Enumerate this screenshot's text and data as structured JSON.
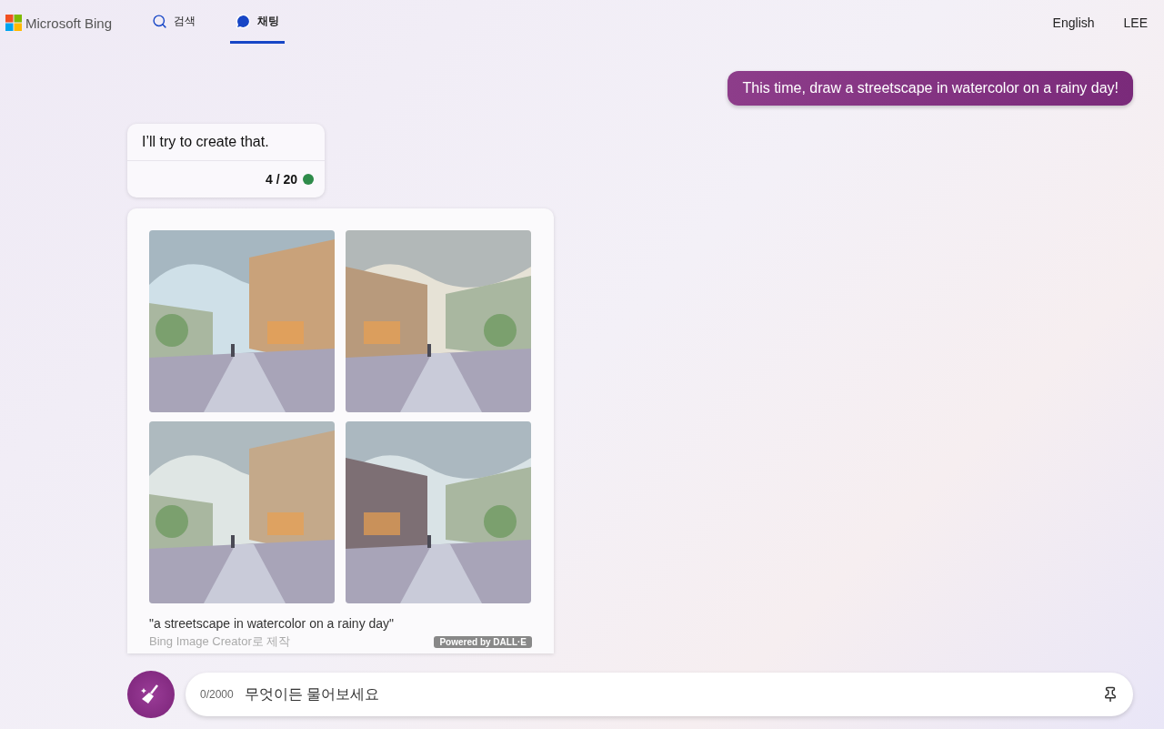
{
  "header": {
    "brand": "Microsoft Bing",
    "tabs": [
      {
        "label": "검색",
        "kind": "search",
        "selected": false
      },
      {
        "label": "채팅",
        "kind": "chat",
        "selected": true
      }
    ],
    "language": "English",
    "user": "LEE"
  },
  "messages": [
    {
      "kind": "user",
      "text": "This time, draw a streetscape in watercolor on a rainy day!"
    },
    {
      "kind": "bot",
      "text": "I’ll try to create that.",
      "count": "4 / 20",
      "color": "#2e8b4a"
    },
    {
      "kind": "images",
      "caption": "\"a streetscape in watercolor on a rainy day\"",
      "credit": "Bing Image Creator로 제작",
      "badge": "Powered by DALL·E"
    }
  ],
  "composer": {
    "placeholder": "무엇이든 물어보세요",
    "counter": "0/2000"
  }
}
